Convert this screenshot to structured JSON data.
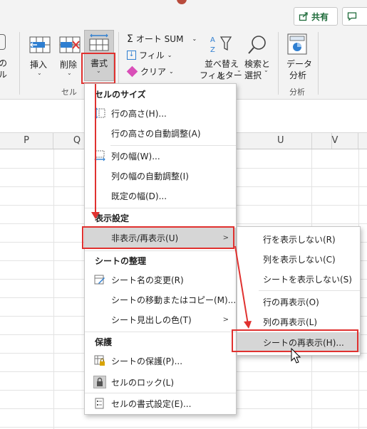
{
  "header": {
    "share_label": "共有",
    "comment_icon": "comment-icon"
  },
  "ribbon": {
    "insert_label": "挿入",
    "delete_label": "削除",
    "format_label": "書式",
    "cells_group": "セル",
    "autosum_label": "オート SUM",
    "fill_label": "フィル",
    "clear_label": "クリア",
    "sort_label_1": "並べ替えと",
    "sort_label_2": "フィルター",
    "find_label_1": "検索と",
    "find_label_2": "選択",
    "data_label_1": "データ",
    "data_label_2": "分析",
    "analysis_group": "分析",
    "cut_left_1": "の",
    "cut_left_2": "ル"
  },
  "columns": {
    "p": "P",
    "q": "Q",
    "u": "U",
    "v": "V"
  },
  "format_menu": {
    "cell_size_header": "セルのサイズ",
    "row_height": "行の高さ(H)...",
    "row_autofit": "行の高さの自動調整(A)",
    "col_width": "列の幅(W)...",
    "col_autofit": "列の幅の自動調整(I)",
    "default_width": "既定の幅(D)...",
    "visibility_header": "表示設定",
    "hide_unhide": "非表示/再表示(U)",
    "organize_header": "シートの整理",
    "rename_sheet": "シート名の変更(R)",
    "move_copy": "シートの移動またはコピー(M)...",
    "tab_color": "シート見出しの色(T)",
    "protection_header": "保護",
    "protect_sheet": "シートの保護(P)...",
    "lock_cell": "セルのロック(L)",
    "format_cells": "セルの書式設定(E)..."
  },
  "submenu": {
    "hide_rows": "行を表示しない(R)",
    "hide_cols": "列を表示しない(C)",
    "hide_sheet": "シートを表示しない(S)",
    "unhide_rows": "行の再表示(O)",
    "unhide_cols": "列の再表示(L)",
    "unhide_sheet": "シートの再表示(H)..."
  },
  "colors": {
    "annotation_red": "#e0312f",
    "highlight": "#d6d6d6",
    "excel_green": "#1e6b3a"
  }
}
